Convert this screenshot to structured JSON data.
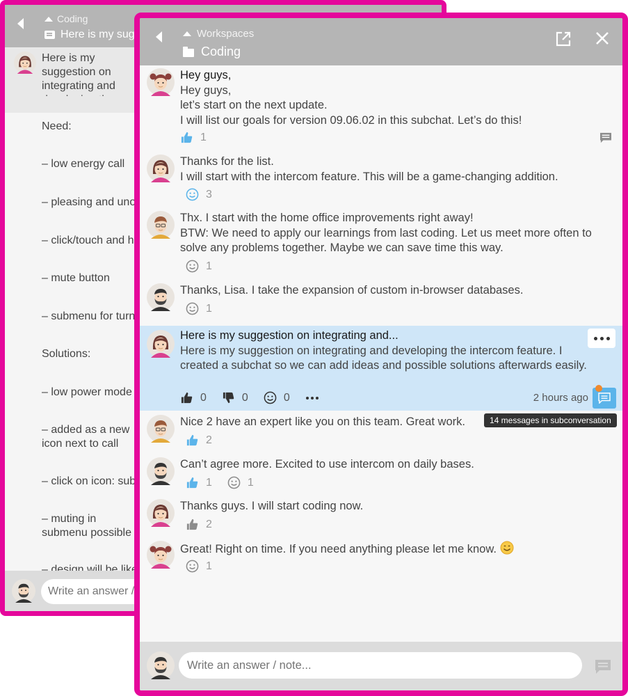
{
  "back_window": {
    "breadcrumb": "Coding",
    "title": "Here is my sugg",
    "message_text": "Here is my suggestion on integrating and developing the intercom feature. I created a subchat so we can add ideas and possible solutions afterwards easily.",
    "list": [
      "Need:",
      "– low energy call",
      "– pleasing and unobtrusive sound",
      "– click/touch and hold",
      "– mute button",
      "– submenu for turning on/off",
      "Solutions:",
      "– low power mode",
      "– added as a new icon next to call function",
      "– click on icon: submenu",
      "– muting in submenu possible at anytime.",
      "– design will be like"
    ],
    "input_placeholder": "Write an answer / note..."
  },
  "front_window": {
    "breadcrumb": "Workspaces",
    "title": "Coding",
    "input_placeholder": "Write an answer / note...",
    "tooltip": "14 messages in subconversation",
    "messages": [
      {
        "title": "Hey guys,",
        "lines": [
          "Hey guys,",
          "let’s start on the next update.",
          "I will list our goals for version 09.06.02 in this subchat. Let’s do this!"
        ],
        "reactions": [
          {
            "icon": "thumbs-up-icon",
            "count": "1"
          }
        ]
      },
      {
        "lines": [
          "Thanks for the list.",
          "I will start with the intercom feature. This will be a game-changing addition."
        ],
        "reactions": [
          {
            "icon": "smiley-icon",
            "count": "3"
          }
        ]
      },
      {
        "lines": [
          "Thx. I start with the home office improvements right away!",
          "BTW: We need to apply our learnings from last coding. Let us meet more often to solve any problems together. Maybe we can save time this way."
        ],
        "reactions": [
          {
            "icon": "smiley-icon",
            "count": "1"
          }
        ]
      },
      {
        "lines": [
          "Thanks, Lisa. I take the expansion of custom in-browser databases."
        ],
        "reactions": [
          {
            "icon": "smiley-icon",
            "count": "1"
          }
        ]
      },
      {
        "title": "Here is my suggestion on integrating and...",
        "lines": [
          "Here is my suggestion on integrating and developing the intercom feature. I created a subchat so we can add ideas and possible solutions afterwards easily."
        ],
        "reactions": [
          {
            "icon": "thumbs-up-icon",
            "count": "0"
          },
          {
            "icon": "thumbs-down-icon",
            "count": "0"
          },
          {
            "icon": "smiley-icon",
            "count": "0"
          }
        ],
        "time": "2 hours ago"
      },
      {
        "lines": [
          "Nice 2 have an expert like you on this team. Great work."
        ],
        "reactions": [
          {
            "icon": "thumbs-up-icon",
            "count": "2"
          }
        ]
      },
      {
        "lines": [
          "Can’t agree more. Excited to use intercom on daily bases."
        ],
        "reactions": [
          {
            "icon": "thumbs-up-icon",
            "count": "1"
          },
          {
            "icon": "smiley-icon",
            "count": "1"
          }
        ]
      },
      {
        "lines": [
          "Thanks guys. I will start coding now."
        ],
        "reactions": [
          {
            "icon": "thumbs-up-icon",
            "count": "2"
          }
        ]
      },
      {
        "lines": [
          "Great! Right on time. If you need anything please let me know."
        ],
        "reactions": [
          {
            "icon": "smiley-icon",
            "count": "1"
          }
        ]
      }
    ]
  },
  "colors": {
    "frame": "#e5079b",
    "header": "#b5b5b5",
    "highlight": "#cfe6f8",
    "accent": "#5bb4ea",
    "badge": "#f08a2e"
  }
}
